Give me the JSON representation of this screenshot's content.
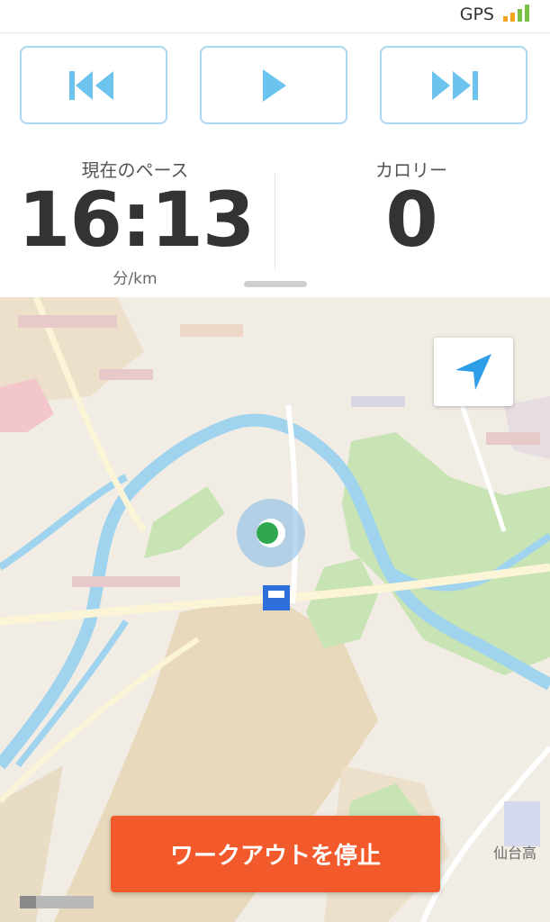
{
  "status_bar": {
    "gps_label": "GPS",
    "signal_bars": 4
  },
  "controls": {
    "previous": "previous-icon",
    "play": "play-icon",
    "next": "next-icon",
    "accent_color": "#6cc3ee"
  },
  "stats": {
    "pace": {
      "label": "現在のペース",
      "value": "16:13",
      "unit": "分/km"
    },
    "calories": {
      "label": "カロリー",
      "value": "0"
    }
  },
  "map": {
    "place_label": "仙台高",
    "locate_icon": "navigation-arrow-icon"
  },
  "actions": {
    "stop_workout": "ワークアウトを停止",
    "stop_color": "#f25a2b"
  }
}
